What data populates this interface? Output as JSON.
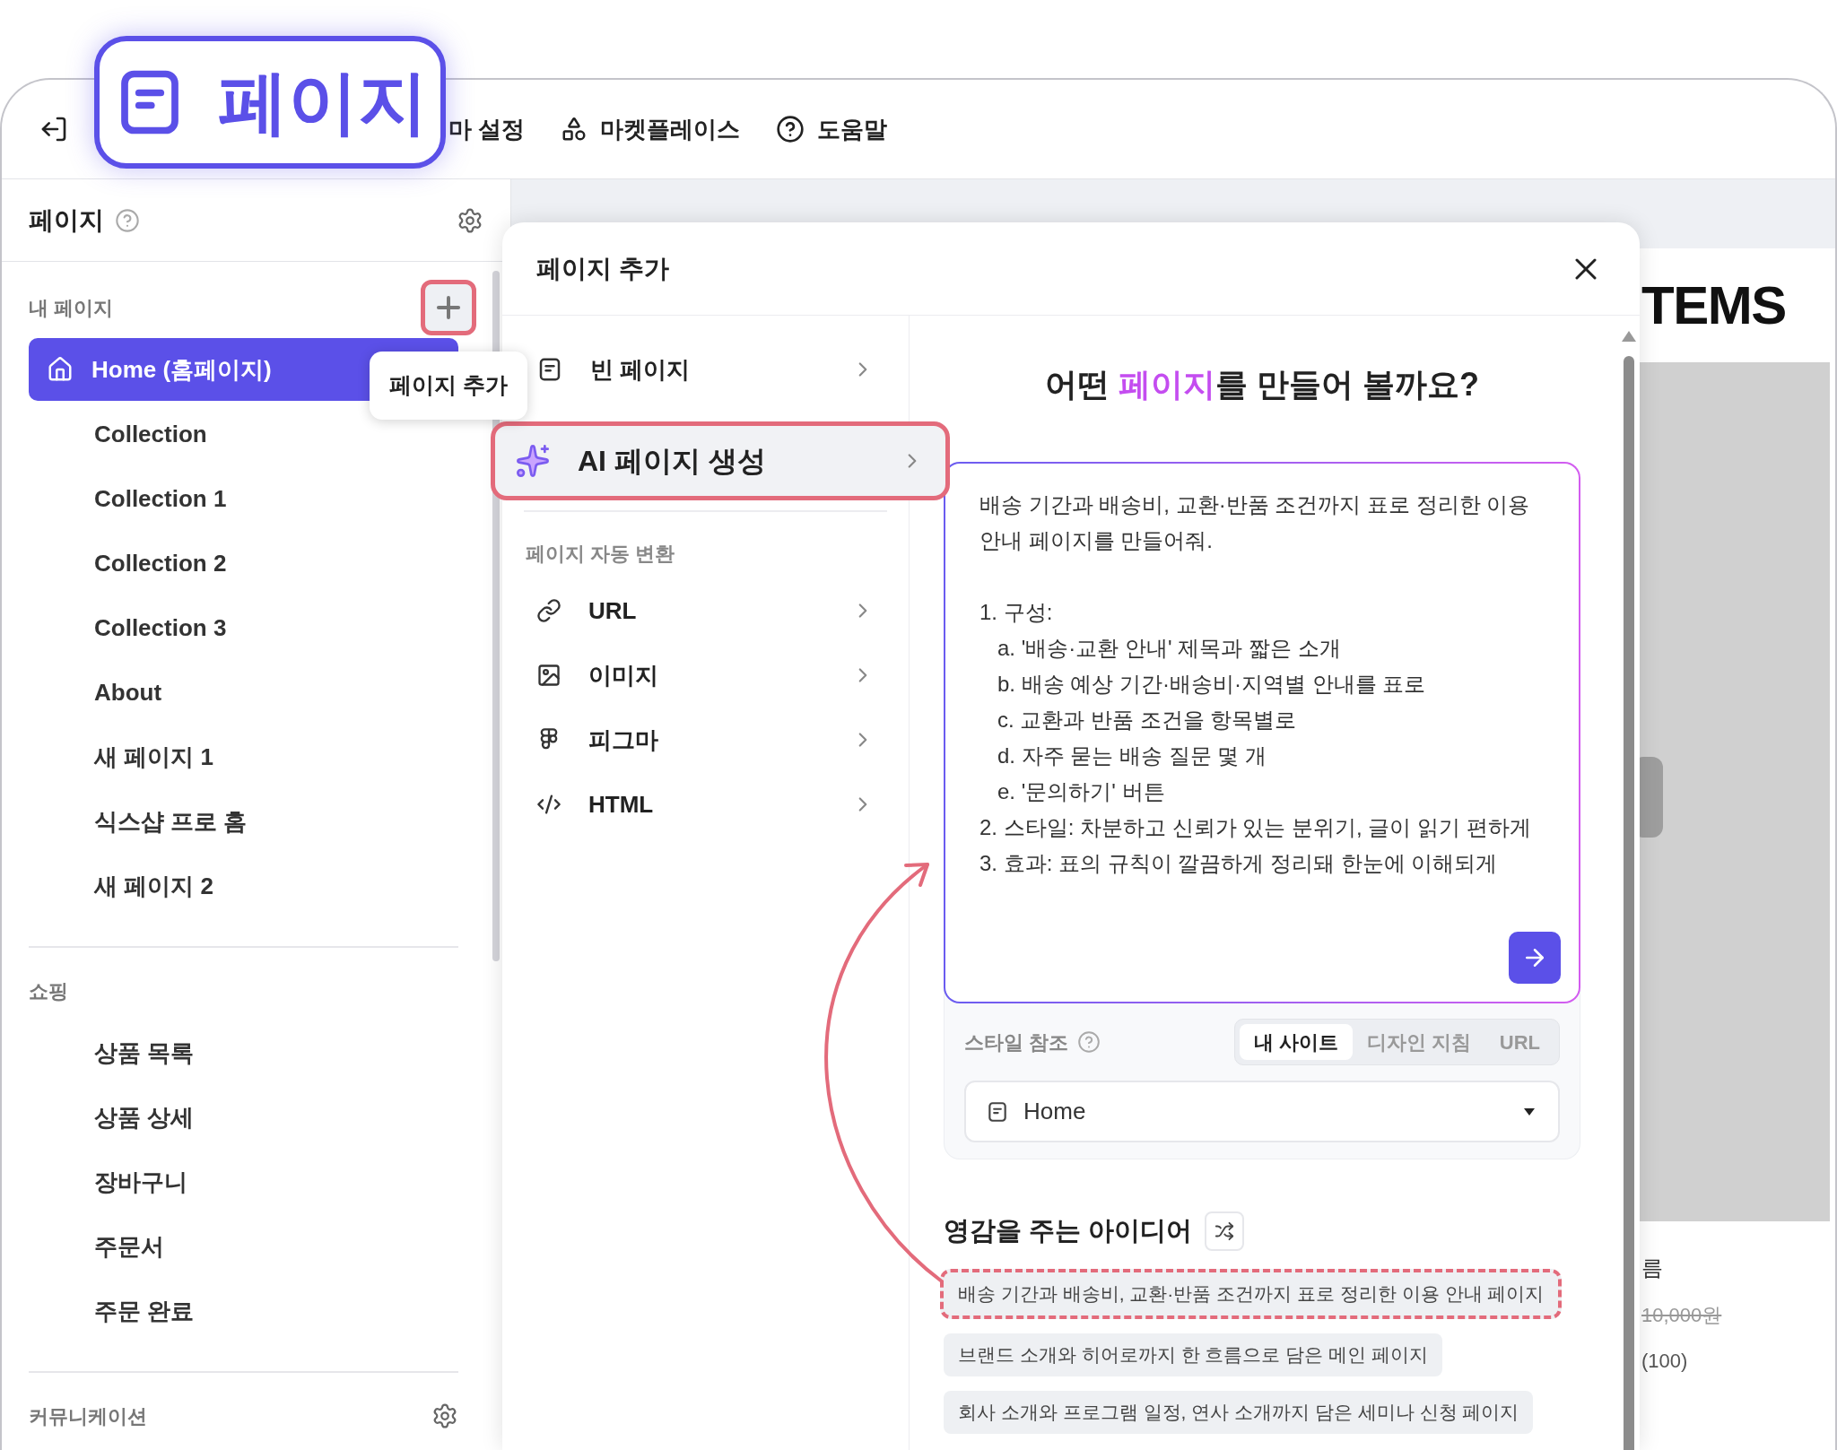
{
  "callout": {
    "label": "페이지"
  },
  "toolbar": {
    "items": [
      {
        "label": "마 설정"
      },
      {
        "label": "마켓플레이스"
      },
      {
        "label": "도움말"
      }
    ]
  },
  "sidebar": {
    "title": "페이지",
    "sections": [
      {
        "title": "내 페이지",
        "add_button": {
          "annotated": true
        },
        "items": [
          {
            "label": "Home (홈페이지)",
            "selected": true
          },
          {
            "label": "Collection",
            "selected": false
          },
          {
            "label": "Collection 1",
            "selected": false
          },
          {
            "label": "Collection 2",
            "selected": false
          },
          {
            "label": "Collection 3",
            "selected": false
          },
          {
            "label": "About",
            "selected": false
          },
          {
            "label": "새 페이지 1",
            "selected": false
          },
          {
            "label": "식스샵 프로 홈",
            "selected": false
          },
          {
            "label": "새 페이지 2",
            "selected": false
          }
        ]
      },
      {
        "title": "쇼핑",
        "items": [
          {
            "label": "상품 목록",
            "selected": false
          },
          {
            "label": "상품 상세",
            "selected": false
          },
          {
            "label": "장바구니",
            "selected": false
          },
          {
            "label": "주문서",
            "selected": false
          },
          {
            "label": "주문 완료",
            "selected": false
          }
        ]
      },
      {
        "title": "커뮤니케이션"
      }
    ]
  },
  "tooltip": "페이지 추가",
  "modal": {
    "title": "페이지 추가",
    "menu": [
      {
        "label": "빈 페이지",
        "selected": false,
        "annotated": false
      },
      {
        "label": "AI 페이지 생성",
        "selected": true,
        "annotated": true
      }
    ],
    "auto_convert": {
      "title": "페이지 자동 변환",
      "items": [
        {
          "label": "URL",
          "selected": false
        },
        {
          "label": "이미지",
          "selected": false
        },
        {
          "label": "피그마",
          "selected": false
        },
        {
          "label": "HTML",
          "selected": false
        }
      ]
    },
    "heading": {
      "before": "어떤 ",
      "highlight": "페이지",
      "after": "를 만들어 볼까요?"
    },
    "prompt": {
      "value": "배송 기간과 배송비, 교환·반품 조건까지 표로 정리한 이용 안내 페이지를 만들어줘.\n\n1. 구성:\n   a. '배송·교환 안내' 제목과 짧은 소개\n   b. 배송 예상 기간·배송비·지역별 안내를 표로\n   c. 교환과 반품 조건을 항목별로\n   d. 자주 묻는 배송 질문 몇 개\n   e. '문의하기' 버튼\n2. 스타일: 차분하고 신뢰가 있는 분위기, 글이 읽기 편하게\n3. 효과: 표의 규칙이 깔끔하게 정리돼 한눈에 이해되게"
    },
    "style_reference": {
      "label": "스타일 참조",
      "tabs": [
        {
          "label": "내 사이트",
          "selected": true
        },
        {
          "label": "디자인 지침",
          "selected": false
        },
        {
          "label": "URL",
          "selected": false
        }
      ],
      "page_select": {
        "value": "Home"
      }
    },
    "ideas": {
      "title": "영감을 주는 아이디어",
      "chips": [
        {
          "label": "배송 기간과 배송비, 교환·반품 조건까지 표로 정리한 이용 안내 페이지",
          "annotated": true
        },
        {
          "label": "브랜드 소개와 히어로까지 한 흐름으로 담은 메인 페이지",
          "annotated": false
        },
        {
          "label": "회사 소개와 프로그램 일정, 연사 소개까지 담은 세미나 신청 페이지",
          "annotated": false
        }
      ]
    }
  },
  "preview": {
    "heading": "TEMS",
    "product_name": "름",
    "price": "10,000원",
    "rating": "(100)"
  }
}
